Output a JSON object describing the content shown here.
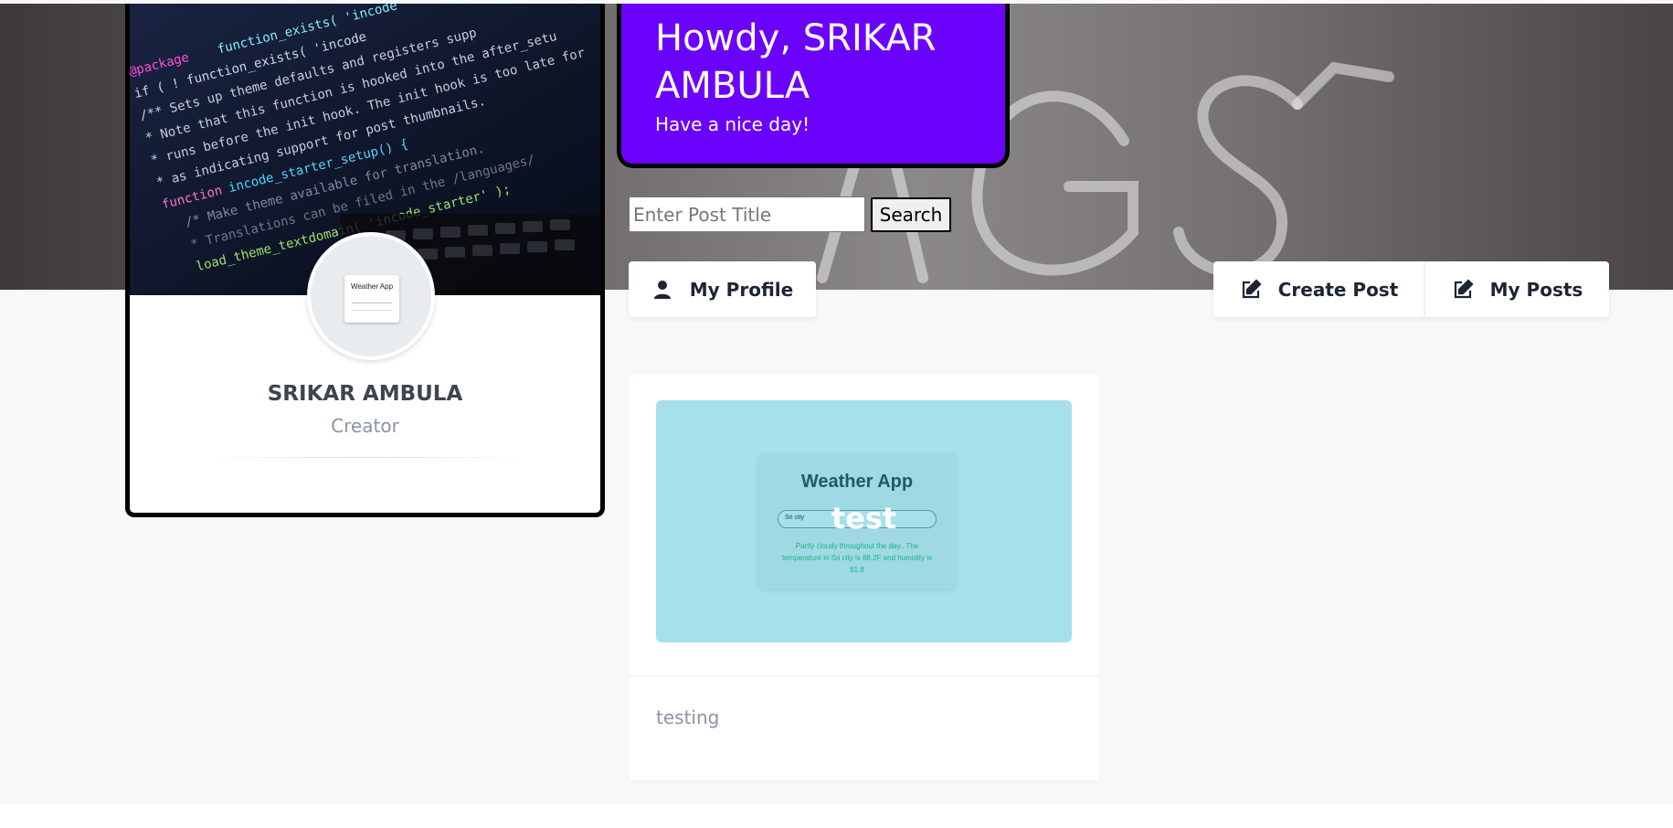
{
  "greeting": {
    "title": "Howdy, SRIKAR AMBULA",
    "subtitle": "Have a nice day!"
  },
  "search": {
    "placeholder": "Enter Post Title",
    "button_label": "Search"
  },
  "profile": {
    "name": "SRIKAR AMBULA",
    "role": "Creator",
    "avatar_thumb_title": "Weather App"
  },
  "nav": {
    "my_profile": "My Profile",
    "create_post": "Create Post",
    "my_posts": "My Posts"
  },
  "posts": [
    {
      "title": "test",
      "description": "testing",
      "preview": {
        "app_title": "Weather App",
        "input_value": "Sri city",
        "result_text": "Partly cloudy throughout the day.. The temperature in Sri city is 88.2F and humidity is 61.8"
      }
    }
  ],
  "colors": {
    "greeting_bg": "#6b02fe",
    "page_bg": "#f7f8fa",
    "preview_bg": "#a6e0eb",
    "preview_text": "#13b885"
  },
  "icons": {
    "my_profile": "user-icon",
    "create_post": "edit-icon",
    "my_posts": "edit-icon"
  }
}
